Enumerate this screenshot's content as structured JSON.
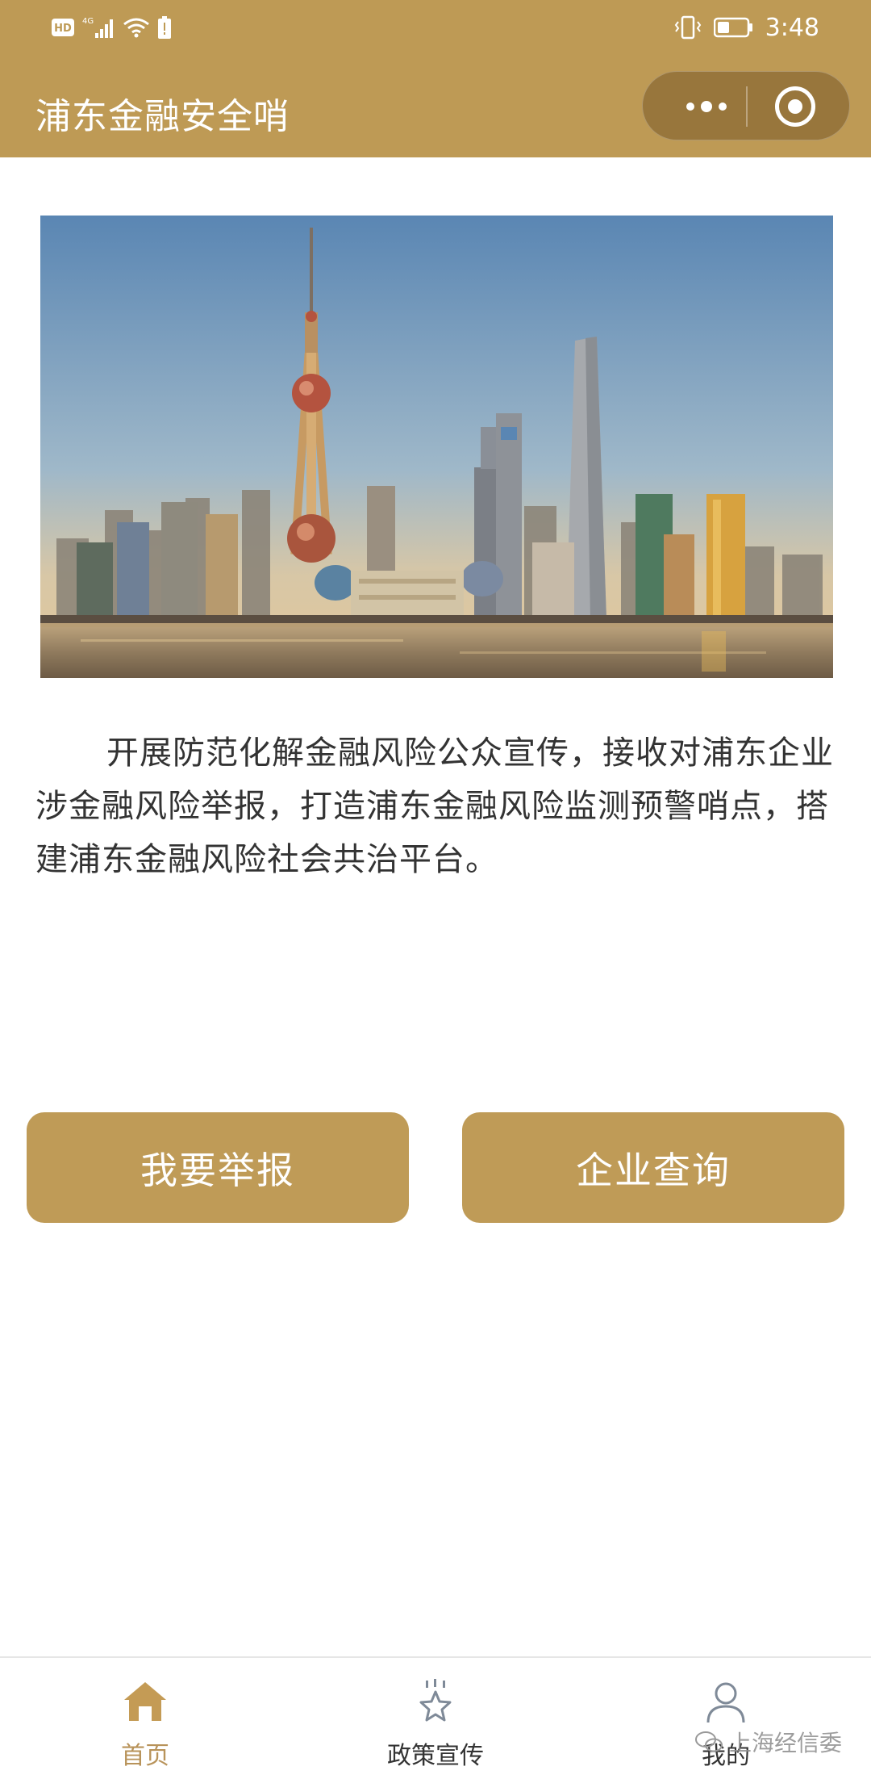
{
  "status_bar": {
    "left_icons": [
      "hd-icon",
      "signal-4g-icon",
      "wifi-icon",
      "battery-alert-icon"
    ],
    "right_icons": [
      "vibrate-icon",
      "battery-icon"
    ],
    "time": "3:48"
  },
  "header": {
    "title": "浦东金融安全哨",
    "bg_color": "#be9a55",
    "capsule_icons": [
      "more-dots-icon",
      "close-circle-icon"
    ]
  },
  "banner": {
    "image_icon": "shanghai-skyline-image"
  },
  "intro": {
    "text": "开展防范化解金融风险公众宣传，接收对浦东企业涉金融风险举报，打造浦东金融风险监测预警哨点，搭建浦东金融风险社会共治平台。"
  },
  "actions": {
    "report_label": "我要举报",
    "query_label": "企业查询",
    "button_color": "#bf9b57"
  },
  "tabbar": {
    "items": [
      {
        "label": "首页",
        "icon": "home-icon",
        "active": true
      },
      {
        "label": "政策宣传",
        "icon": "star-icon",
        "active": false
      },
      {
        "label": "我的",
        "icon": "user-icon",
        "active": false
      }
    ],
    "active_color": "#b8935a"
  },
  "watermark": {
    "text": "上海经信委",
    "icon": "wechat-icon"
  }
}
